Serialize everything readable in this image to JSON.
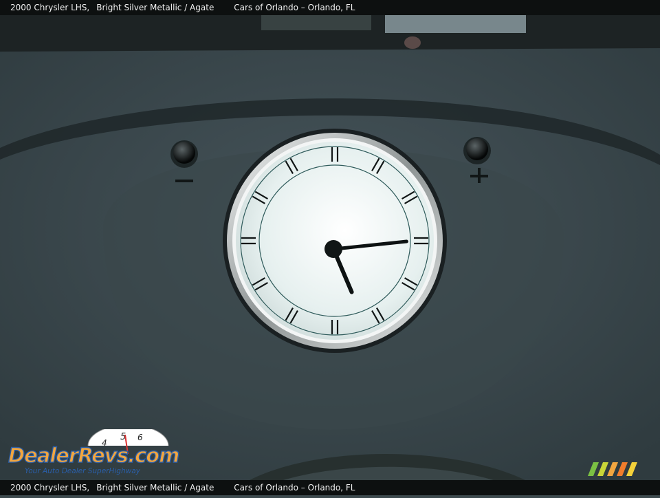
{
  "caption": {
    "vehicle": "2000 Chrysler LHS,",
    "color": "Bright Silver Metallic / Agate",
    "dealer": "Cars of Orlando – Orlando, FL"
  },
  "clock": {
    "time": "5:14",
    "hour": 5,
    "minute": 14,
    "markers": 12
  },
  "controls": {
    "minus_symbol": "−",
    "plus_symbol": "+"
  },
  "watermark": {
    "brand": "DealerRevs.com",
    "tagline": "Your Auto Dealer SuperHighway",
    "gauge_digits": [
      "4",
      "5",
      "6"
    ]
  },
  "colors": {
    "dash": "#3d4a4e",
    "clock_face": "#e9f1f1",
    "bezel": "#c9cccc",
    "brand_orange": "#f2a640",
    "brand_blue": "#2a5ea8"
  }
}
